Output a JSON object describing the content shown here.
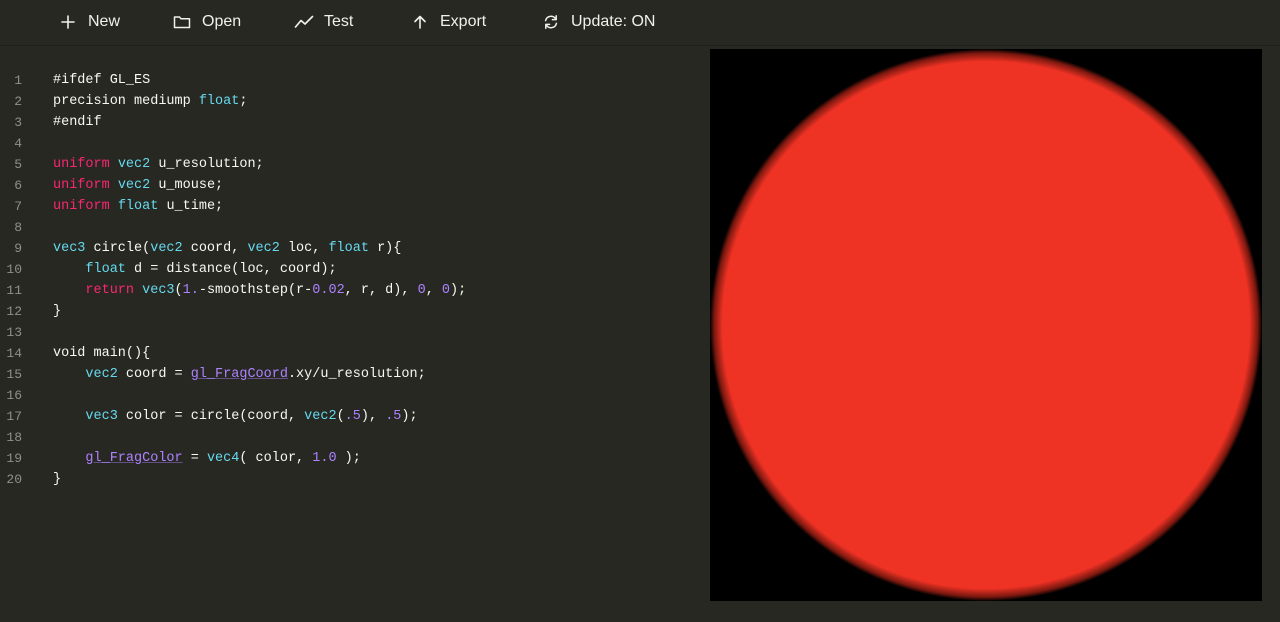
{
  "toolbar": {
    "buttons": [
      {
        "label": "New",
        "icon": "plus-icon"
      },
      {
        "label": "Open",
        "icon": "folder-icon"
      },
      {
        "label": "Test",
        "icon": "line-chart-icon"
      },
      {
        "label": "Export",
        "icon": "arrow-up-icon"
      },
      {
        "label": "Update: ON",
        "icon": "refresh-icon"
      }
    ]
  },
  "editor": {
    "lines": [
      {
        "num": "1",
        "tokens": [
          {
            "t": "#ifdef GL_ES",
            "c": "plain"
          }
        ]
      },
      {
        "num": "2",
        "tokens": [
          {
            "t": "precision mediump ",
            "c": "plain"
          },
          {
            "t": "float",
            "c": "type"
          },
          {
            "t": ";",
            "c": "plain"
          }
        ]
      },
      {
        "num": "3",
        "tokens": [
          {
            "t": "#endif",
            "c": "plain"
          }
        ]
      },
      {
        "num": "4",
        "tokens": []
      },
      {
        "num": "5",
        "tokens": [
          {
            "t": "uniform",
            "c": "kw"
          },
          {
            "t": " ",
            "c": "plain"
          },
          {
            "t": "vec2",
            "c": "type"
          },
          {
            "t": " u_resolution;",
            "c": "plain"
          }
        ]
      },
      {
        "num": "6",
        "tokens": [
          {
            "t": "uniform",
            "c": "kw"
          },
          {
            "t": " ",
            "c": "plain"
          },
          {
            "t": "vec2",
            "c": "type"
          },
          {
            "t": " u_mouse;",
            "c": "plain"
          }
        ]
      },
      {
        "num": "7",
        "tokens": [
          {
            "t": "uniform",
            "c": "kw"
          },
          {
            "t": " ",
            "c": "plain"
          },
          {
            "t": "float",
            "c": "type"
          },
          {
            "t": " u_time;",
            "c": "plain"
          }
        ]
      },
      {
        "num": "8",
        "tokens": []
      },
      {
        "num": "9",
        "tokens": [
          {
            "t": "vec3",
            "c": "type"
          },
          {
            "t": " circle(",
            "c": "plain"
          },
          {
            "t": "vec2",
            "c": "type"
          },
          {
            "t": " coord, ",
            "c": "plain"
          },
          {
            "t": "vec2",
            "c": "type"
          },
          {
            "t": " loc, ",
            "c": "plain"
          },
          {
            "t": "float",
            "c": "type"
          },
          {
            "t": " r){",
            "c": "plain"
          }
        ]
      },
      {
        "num": "10",
        "tokens": [
          {
            "t": "    ",
            "c": "plain"
          },
          {
            "t": "float",
            "c": "type"
          },
          {
            "t": " d = distance(loc, coord);",
            "c": "plain"
          }
        ]
      },
      {
        "num": "11",
        "tokens": [
          {
            "t": "    ",
            "c": "plain"
          },
          {
            "t": "return",
            "c": "kw"
          },
          {
            "t": " ",
            "c": "plain"
          },
          {
            "t": "vec3",
            "c": "type"
          },
          {
            "t": "(",
            "c": "plain"
          },
          {
            "t": "1.",
            "c": "num"
          },
          {
            "t": "-smoothstep(r-",
            "c": "plain"
          },
          {
            "t": "0.02",
            "c": "num"
          },
          {
            "t": ", r, d), ",
            "c": "plain"
          },
          {
            "t": "0",
            "c": "num"
          },
          {
            "t": ", ",
            "c": "plain"
          },
          {
            "t": "0",
            "c": "num"
          },
          {
            "t": ");",
            "c": "plain"
          }
        ]
      },
      {
        "num": "12",
        "tokens": [
          {
            "t": "}",
            "c": "plain"
          }
        ]
      },
      {
        "num": "13",
        "tokens": []
      },
      {
        "num": "14",
        "tokens": [
          {
            "t": "void main(){",
            "c": "plain"
          }
        ]
      },
      {
        "num": "15",
        "tokens": [
          {
            "t": "    ",
            "c": "plain"
          },
          {
            "t": "vec2",
            "c": "type"
          },
          {
            "t": " coord = ",
            "c": "plain"
          },
          {
            "t": "gl_FragCoord",
            "c": "builtin"
          },
          {
            "t": ".xy/u_resolution;",
            "c": "plain"
          }
        ]
      },
      {
        "num": "16",
        "tokens": []
      },
      {
        "num": "17",
        "tokens": [
          {
            "t": "    ",
            "c": "plain"
          },
          {
            "t": "vec3",
            "c": "type"
          },
          {
            "t": " color = circle(coord, ",
            "c": "plain"
          },
          {
            "t": "vec2",
            "c": "type"
          },
          {
            "t": "(",
            "c": "plain"
          },
          {
            "t": ".5",
            "c": "num"
          },
          {
            "t": "), ",
            "c": "plain"
          },
          {
            "t": ".5",
            "c": "num"
          },
          {
            "t": ");",
            "c": "plain"
          }
        ]
      },
      {
        "num": "18",
        "tokens": []
      },
      {
        "num": "19",
        "tokens": [
          {
            "t": "    ",
            "c": "plain"
          },
          {
            "t": "gl_FragColor",
            "c": "builtin"
          },
          {
            "t": " = ",
            "c": "plain"
          },
          {
            "t": "vec4",
            "c": "type"
          },
          {
            "t": "( color, ",
            "c": "plain"
          },
          {
            "t": "1.0",
            "c": "num"
          },
          {
            "t": " );",
            "c": "plain"
          }
        ]
      },
      {
        "num": "20",
        "tokens": [
          {
            "t": "}",
            "c": "plain"
          }
        ]
      }
    ]
  },
  "preview": {
    "background": "#000000",
    "circle_color": "#ee3224"
  },
  "colors": {
    "editor_bg": "#272822",
    "keyword": "#f92672",
    "type": "#66d9ef",
    "number": "#ae81ff",
    "text": "#f8f8f2",
    "line_number": "#8f908a"
  }
}
